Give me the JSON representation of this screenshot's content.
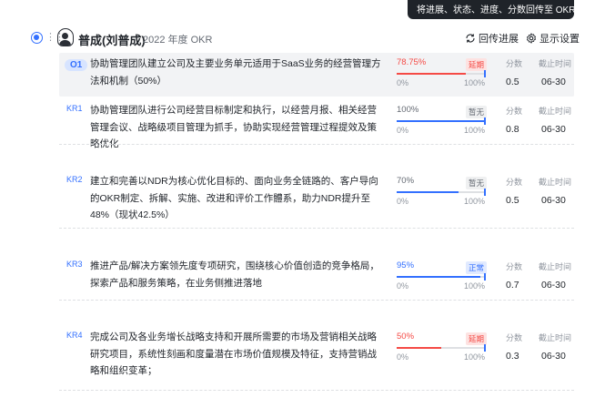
{
  "tooltip": "将进展、状态、进度、分数回传至 OKR 系统",
  "header": {
    "name": "普成(刘普成)",
    "period": "2022 年度 OKR",
    "sync_label": "回传进展",
    "settings_label": "显示设置",
    "icons": [
      "collapse-icon",
      "drag-handle-icon",
      "avatar-icon",
      "sync-icon",
      "gear-icon"
    ]
  },
  "columns": {
    "score": "分数",
    "deadline": "截止时间"
  },
  "colors": {
    "accent": "#3370ff",
    "danger": "#f54a45",
    "success": "#3370ff",
    "neutral": "#646a73"
  },
  "items": [
    {
      "tag": "O1",
      "title": "协助管理团队建立公司及主要业务单元适用于SaaS业务的经营管理方法和机制（50%）",
      "progress_label": "78.75%",
      "progress": 0.7875,
      "status": "延期",
      "min_label": "0%",
      "max_label": "100%",
      "score": "0.5",
      "deadline": "06-30"
    },
    {
      "tag": "KR1",
      "title": "协助管理团队进行公司经营目标制定和执行，以经营月报、相关经营管理会议、战略级项目管理为抓手，协助实现经营管理过程提效及策略优化",
      "progress_label": "100%",
      "progress": 1.0,
      "status": "暂无",
      "min_label": "0%",
      "max_label": "100%",
      "score": "0.8",
      "deadline": "06-30"
    },
    {
      "tag": "KR2",
      "title": "建立和完善以NDR为核心优化目标的、面向业务全链路的、客户导向的OKR制定、拆解、实施、改进和评价工作體系，助力NDR提升至48%（现状42.5%）",
      "progress_label": "70%",
      "progress": 0.7,
      "status": "暂无",
      "min_label": "0%",
      "max_label": "100%",
      "score": "0.5",
      "deadline": "06-30"
    },
    {
      "tag": "KR3",
      "title": "推进产品/解决方案领先度专项研究，围绕核心价值创造的竞争格局，探索产品和服务策略，在业务侧推进落地",
      "progress_label": "95%",
      "progress": 0.95,
      "status": "正常",
      "min_label": "0%",
      "max_label": "100%",
      "score": "0.7",
      "deadline": "06-30"
    },
    {
      "tag": "KR4",
      "title": "完成公司及各业务增长战略支持和开展所需要的市场及营销相关战略研究项目，系统性刻画和度量潜在市场价值规模及特征，支持营销战略和组织变革；",
      "progress_label": "50%",
      "progress": 0.5,
      "status": "延期",
      "min_label": "0%",
      "max_label": "100%",
      "score": "0.3",
      "deadline": "06-30"
    }
  ]
}
